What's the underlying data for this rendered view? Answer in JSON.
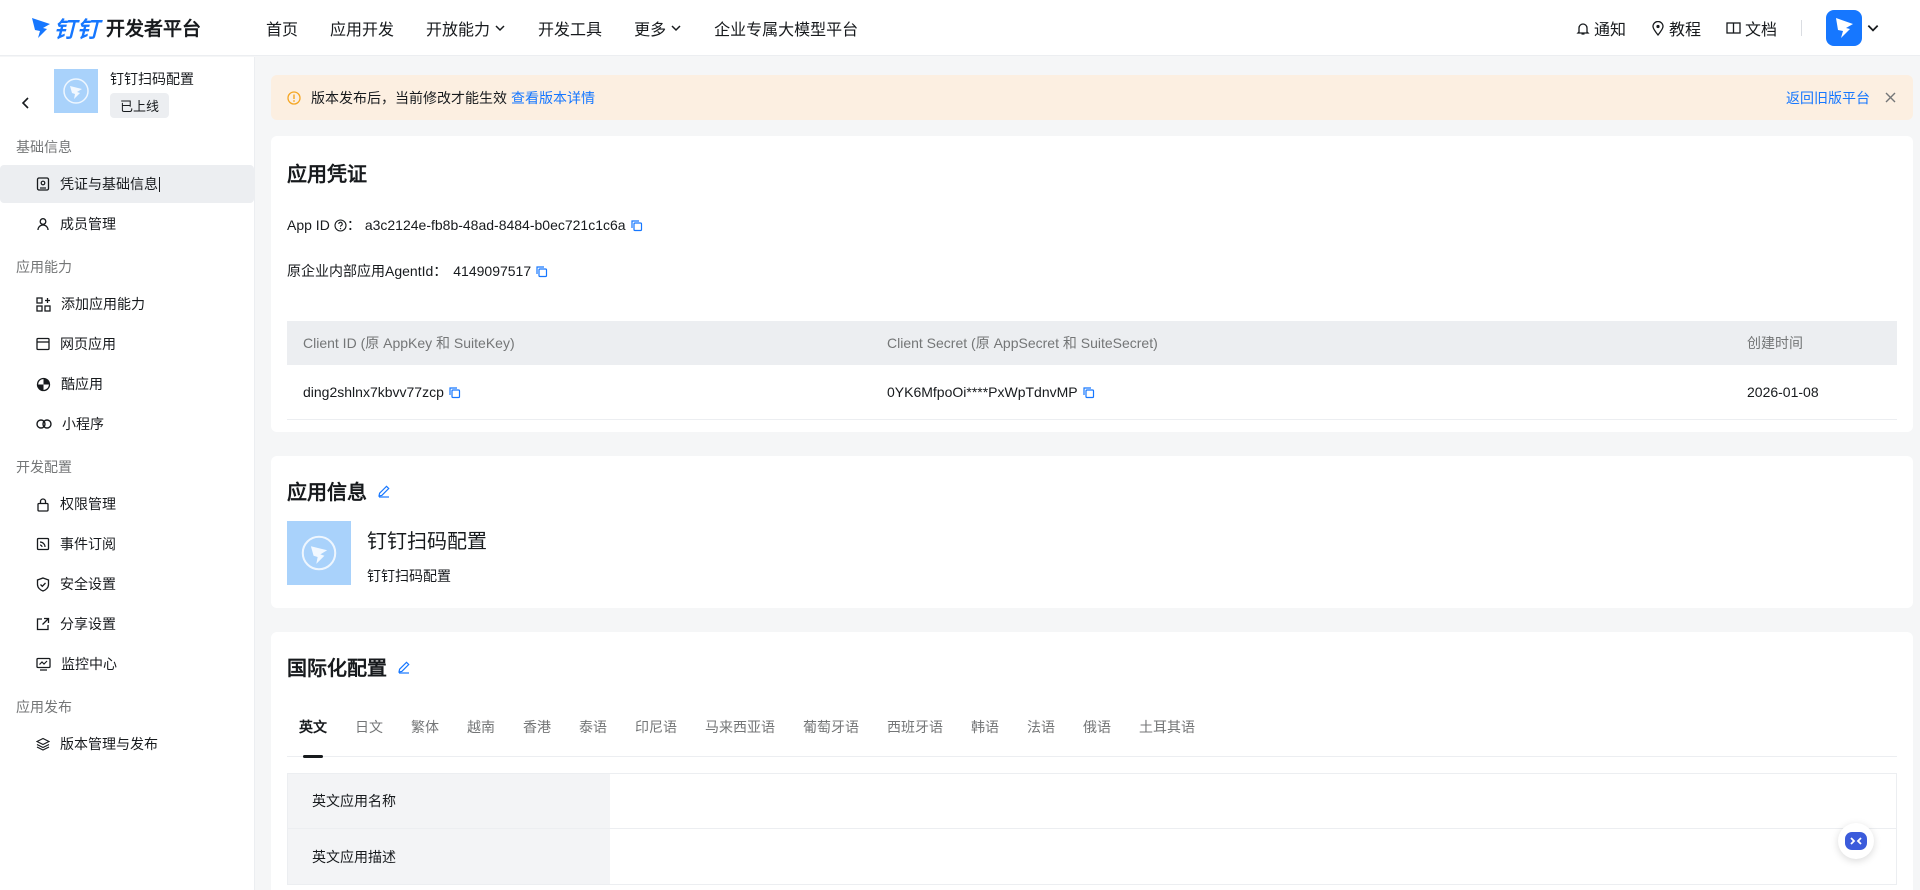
{
  "topbar": {
    "logo_text": "钉钉",
    "platform": "开发者平台",
    "nav": [
      {
        "label": "首页",
        "dropdown": false
      },
      {
        "label": "应用开发",
        "dropdown": false
      },
      {
        "label": "开放能力",
        "dropdown": true
      },
      {
        "label": "开发工具",
        "dropdown": false
      },
      {
        "label": "更多",
        "dropdown": true
      },
      {
        "label": "企业专属大模型平台",
        "dropdown": false
      }
    ],
    "notify": "通知",
    "tutorial": "教程",
    "docs": "文档"
  },
  "sidebar": {
    "app_name": "钉钉扫码配置",
    "app_status": "已上线",
    "groups": [
      {
        "title": "基础信息",
        "items": [
          {
            "label": "凭证与基础信息",
            "icon": "credential-icon",
            "active": true
          },
          {
            "label": "成员管理",
            "icon": "user-icon",
            "active": false
          }
        ]
      },
      {
        "title": "应用能力",
        "items": [
          {
            "label": "添加应用能力",
            "icon": "add-capability-icon",
            "active": false
          },
          {
            "label": "网页应用",
            "icon": "web-app-icon",
            "active": false
          },
          {
            "label": "酷应用",
            "icon": "cool-app-icon",
            "active": false
          },
          {
            "label": "小程序",
            "icon": "mini-program-icon",
            "active": false
          }
        ]
      },
      {
        "title": "开发配置",
        "items": [
          {
            "label": "权限管理",
            "icon": "lock-icon",
            "active": false
          },
          {
            "label": "事件订阅",
            "icon": "event-icon",
            "active": false
          },
          {
            "label": "安全设置",
            "icon": "shield-icon",
            "active": false
          },
          {
            "label": "分享设置",
            "icon": "share-icon",
            "active": false
          },
          {
            "label": "监控中心",
            "icon": "monitor-icon",
            "active": false
          }
        ]
      },
      {
        "title": "应用发布",
        "items": [
          {
            "label": "版本管理与发布",
            "icon": "layers-icon",
            "active": false
          }
        ]
      }
    ]
  },
  "notice": {
    "text": "版本发布后，当前修改才能生效",
    "link": "查看版本详情",
    "back": "返回旧版平台"
  },
  "credentials": {
    "title": "应用凭证",
    "app_id_label": "App ID",
    "app_id_sep": "：",
    "app_id": "a3c2124e-fb8b-48ad-8484-b0ec721c1c6a",
    "agent_label": "原企业内部应用AgentId：",
    "agent_id": "4149097517",
    "table": {
      "headers": [
        "Client ID (原 AppKey 和 SuiteKey)",
        "Client Secret (原 AppSecret 和 SuiteSecret)",
        "创建时间"
      ],
      "rows": [
        {
          "client_id": "ding2shlnx7kbvv77zcp",
          "client_secret": "0YK6MfpoOi****PxWpTdnvMP",
          "created": "2026-01-08"
        }
      ]
    }
  },
  "app_info": {
    "title": "应用信息",
    "name": "钉钉扫码配置",
    "desc": "钉钉扫码配置"
  },
  "i18n": {
    "title": "国际化配置",
    "tabs": [
      "英文",
      "日文",
      "繁体",
      "越南",
      "香港",
      "泰语",
      "印尼语",
      "马来西亚语",
      "葡萄牙语",
      "西班牙语",
      "韩语",
      "法语",
      "俄语",
      "土耳其语"
    ],
    "active_tab": 0,
    "fields": [
      {
        "label": "英文应用名称",
        "value": ""
      },
      {
        "label": "英文应用描述",
        "value": ""
      }
    ]
  },
  "colors": {
    "accent": "#1677ff",
    "notice_bg": "#fcefe1",
    "thumb_bg": "#a9d2fb"
  }
}
